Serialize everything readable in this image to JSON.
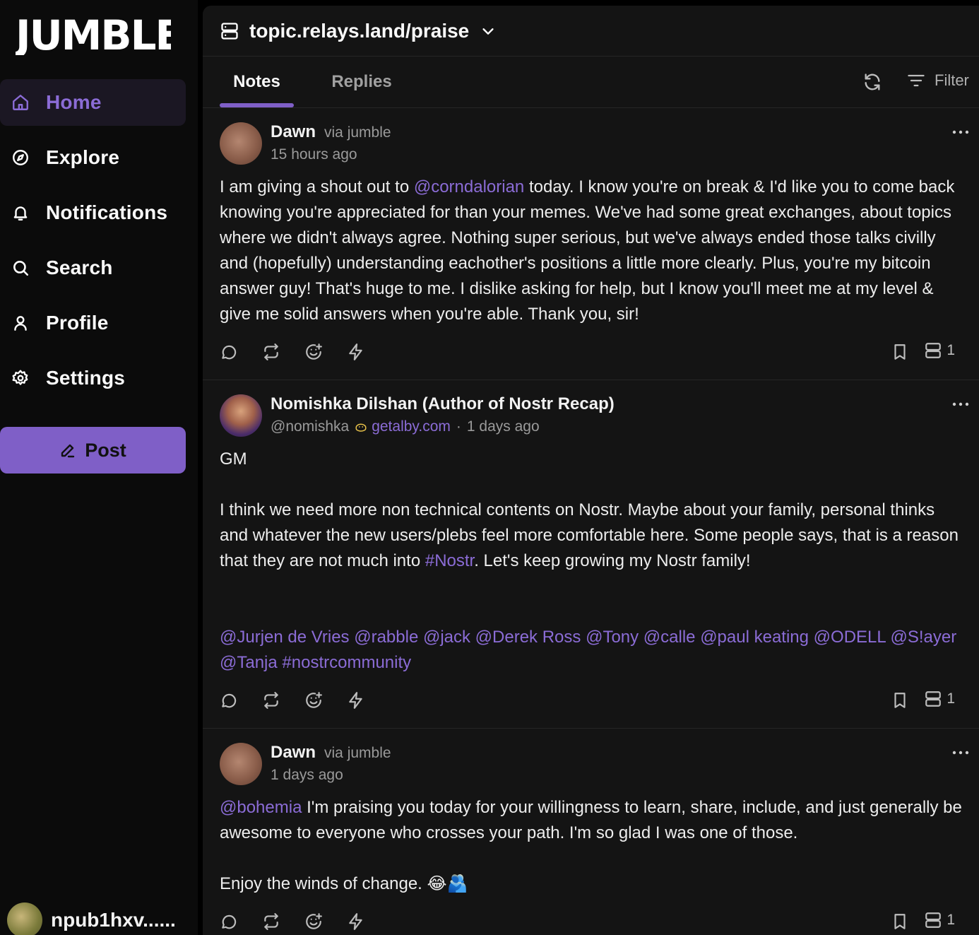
{
  "sidebar": {
    "logo_text": "JUMBLE",
    "nav": [
      {
        "label": "Home",
        "icon": "home-icon",
        "active": true
      },
      {
        "label": "Explore",
        "icon": "compass-icon"
      },
      {
        "label": "Notifications",
        "icon": "bell-icon"
      },
      {
        "label": "Search",
        "icon": "search-icon"
      },
      {
        "label": "Profile",
        "icon": "user-icon"
      },
      {
        "label": "Settings",
        "icon": "gear-icon"
      }
    ],
    "post_label": "Post",
    "account_name": "npub1hxv......"
  },
  "header": {
    "relay_title": "topic.relays.land/praise"
  },
  "tabs": {
    "notes": "Notes",
    "replies": "Replies",
    "filter": "Filter"
  },
  "notes": [
    {
      "author": "Dawn",
      "client": "via jumble",
      "time": "15 hours ago",
      "body_parts": {
        "p1": "I am giving a shout out to ",
        "m1": "@corndalorian",
        "p2": " today. I know you're on break & I'd like you to come back knowing you're appreciated for than your memes. We've had some great exchanges, about topics where we didn't always agree. Nothing super serious, but we've always ended those talks civilly and (hopefully) understanding eachother's positions a little more clearly. Plus, you're my bitcoin answer guy! That's huge to me. I dislike asking for help, but I know you'll meet me at my level & give me solid answers when you're able. Thank you, sir!"
      },
      "relay_count": "1"
    },
    {
      "author": "Nomishka Dilshan (Author of Nostr Recap)",
      "handle": "@nomishka",
      "nip05_domain": "getalby.com",
      "time": "1 days ago",
      "body_parts": {
        "p1": "GM\n\nI think we need more non technical contents on Nostr. Maybe about your family, personal thinks and whatever the new users/plebs feel more comfortable here. Some people says, that is a reason that they are not much into ",
        "tag1": "#Nostr",
        "p2": ". Let's keep growing my Nostr family!\n\n\n",
        "mentions": "@Jurjen de Vries @rabble @jack @Derek Ross @Tony @calle @paul keating @ODELL @S!ayer @Tanja #nostrcommunity"
      },
      "relay_count": "1"
    },
    {
      "author": "Dawn",
      "client": "via jumble",
      "time": "1 days ago",
      "body_parts": {
        "m1": "@bohemia",
        "p1": " I'm praising you today for your willingness to learn, share, include, and just generally be awesome to everyone who crosses your path. I'm so glad I was one of those.\n\nEnjoy the winds of change. 😂🫂"
      },
      "relay_count": "1"
    }
  ],
  "colors": {
    "accent": "#7f5fc7",
    "link": "#8b6cd6",
    "background": "#141414",
    "sidebar": "#0b0b0b"
  }
}
